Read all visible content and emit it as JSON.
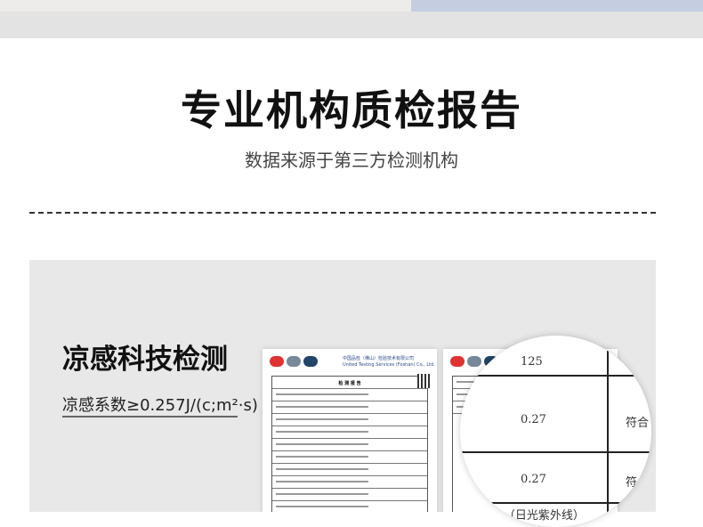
{
  "header": {
    "title": "专业机构质检报告",
    "subtitle": "数据来源于第三方检测机构"
  },
  "feature": {
    "heading": "凉感科技检测",
    "spec": "凉感系数≥0.257J/(c;m²·s)"
  },
  "report": {
    "org_cn": "中国品检（佛山）检验技术有限公司",
    "org_en": "United Testing Services (Foshan) Co., Ltd.",
    "table_title": "检 测 报 告"
  },
  "magnifier": {
    "top_value": "125",
    "value_1": "0.27",
    "value_2": "0.27",
    "result_1": "符合",
    "result_2": "符合",
    "bottom_label": "UVA（日光紫外线）"
  }
}
